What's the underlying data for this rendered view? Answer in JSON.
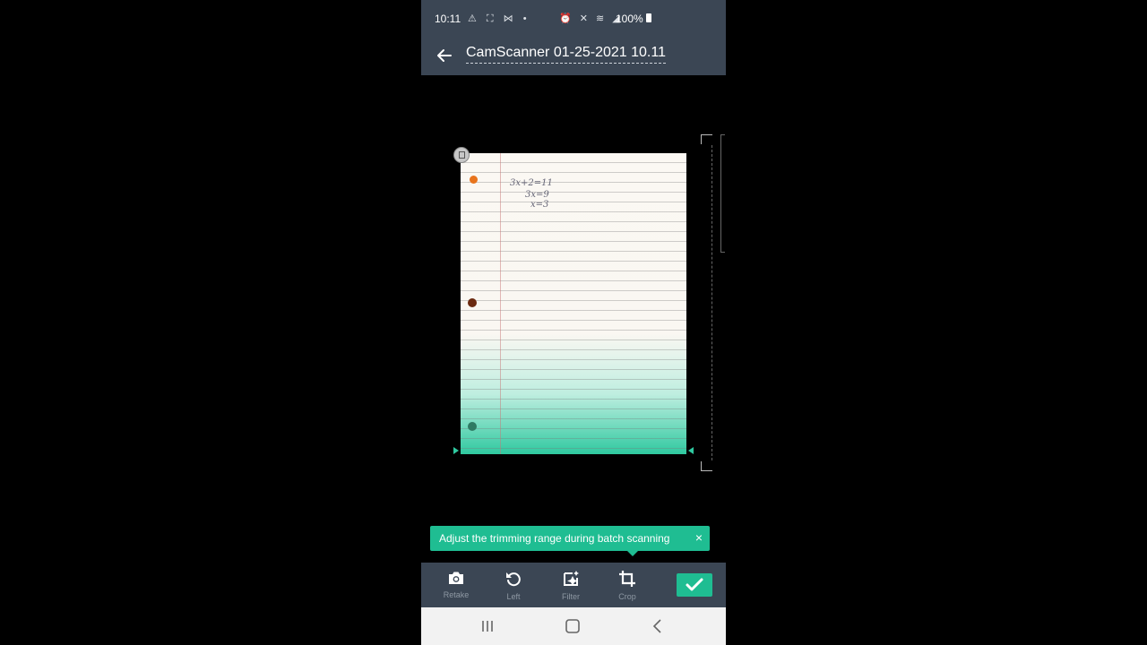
{
  "status_bar": {
    "time": "10:11",
    "left_icons": "⚠ ⛶ ⋈ •",
    "right_icons": "⏰ ✕ ≋ ◢",
    "battery": "100%"
  },
  "header": {
    "back_icon": "arrow-left-icon",
    "title": "CamScanner 01-25-2021 10.11"
  },
  "document": {
    "handwriting": [
      "3x+2=11",
      "3x=9",
      "x=3"
    ]
  },
  "tip": {
    "text": "Adjust the trimming range during batch scanning",
    "close": "×"
  },
  "toolbar": {
    "items": [
      {
        "label": "Retake",
        "icon": "camera-icon"
      },
      {
        "label": "Left",
        "icon": "rotate-left-icon"
      },
      {
        "label": "Filter",
        "icon": "filter-icon"
      },
      {
        "label": "Crop",
        "icon": "crop-icon"
      }
    ],
    "confirm_icon": "check-icon"
  },
  "colors": {
    "app_bar": "#3b4654",
    "accent": "#1fbd92"
  }
}
